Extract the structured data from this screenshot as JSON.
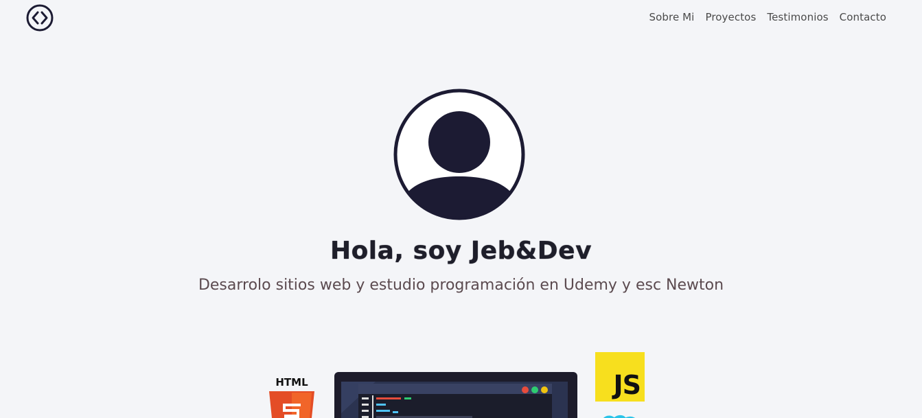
{
  "header": {
    "logo_icon": "code-brackets-icon",
    "nav": [
      {
        "label": "Sobre Mi"
      },
      {
        "label": "Proyectos"
      },
      {
        "label": "Testimonios"
      },
      {
        "label": "Contacto"
      }
    ]
  },
  "hero": {
    "avatar_icon": "user-avatar-icon",
    "title": "Hola, soy Jeb&Dev",
    "subtitle": "Desarrolo sitios web y estudio programación en Udemy y esc Newton"
  },
  "skills": {
    "html_label": "HTML",
    "js_label": "JS",
    "html_icon": "html5-icon",
    "js_icon": "javascript-icon",
    "laptop_icon": "laptop-code-icon",
    "css_icon": "css-icon"
  },
  "colors": {
    "background": "#f4f5f8",
    "dark": "#1c1b33",
    "html_orange": "#e44d26",
    "js_yellow": "#f7df1e"
  }
}
